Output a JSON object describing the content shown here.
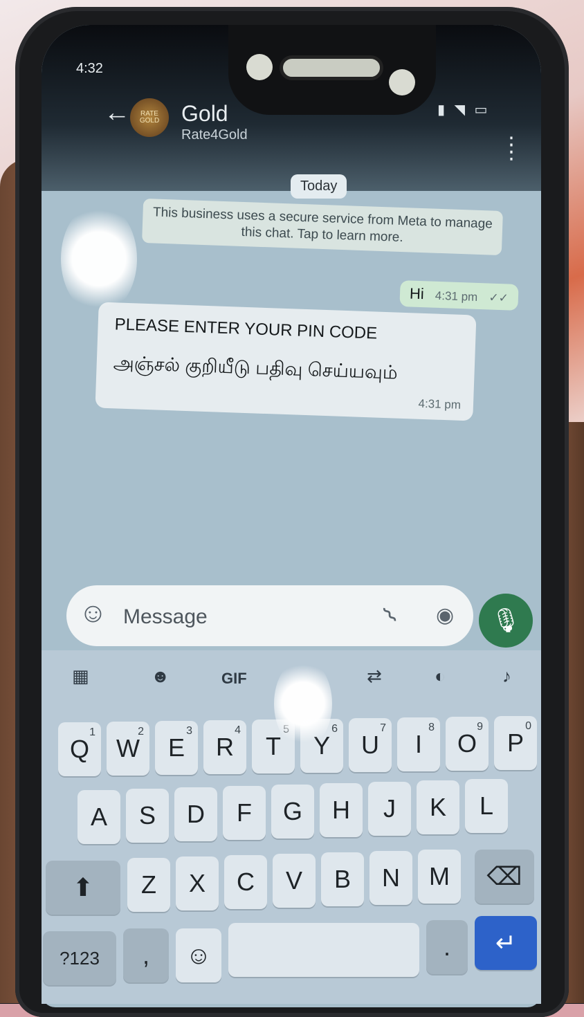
{
  "status_bar": {
    "time": "4:32",
    "icons": "▮ ◥ ▭"
  },
  "chat": {
    "back_icon": "back-arrow-icon",
    "avatar_text": "RATE GOLD",
    "name": "Gold",
    "subtitle": "Rate4Gold",
    "menu_icon": "more-vertical-icon"
  },
  "messages": {
    "date_label": "Today",
    "system_notice": "This business uses a secure service from Meta to manage this chat. Tap to learn more.",
    "outgoing": {
      "text": "Hi",
      "time": "4:31 pm",
      "ticks": "✓✓"
    },
    "incoming": {
      "line1": "PLEASE ENTER YOUR PIN CODE",
      "line2": "அஞ்சல் குறியீடு பதிவு செய்யவும்",
      "time": "4:31 pm"
    }
  },
  "composer": {
    "placeholder": "Message",
    "emoji_icon": "emoji-icon",
    "attach_icon": "paperclip-icon",
    "camera_icon": "camera-icon",
    "mic_icon": "microphone-icon"
  },
  "keyboard": {
    "toolbar": [
      "grid-icon",
      "sticker-icon",
      "GIF",
      "translate-icon",
      "palette-icon",
      "microphone-icon"
    ],
    "gif_label": "GIF",
    "row1": [
      "Q",
      "W",
      "E",
      "R",
      "T",
      "Y",
      "U",
      "I",
      "O",
      "P"
    ],
    "row1_hints": [
      "1",
      "2",
      "3",
      "4",
      "5",
      "6",
      "7",
      "8",
      "9",
      "0"
    ],
    "row2": [
      "A",
      "S",
      "D",
      "F",
      "G",
      "H",
      "J",
      "K",
      "L"
    ],
    "row3": [
      "Z",
      "X",
      "C",
      "V",
      "B",
      "N",
      "M"
    ],
    "symbols_label": "?123",
    "comma_label": ",",
    "period_label": ".",
    "shift_glyph": "⬆",
    "backspace_glyph": "⌫",
    "enter_glyph": "↵",
    "emoji_glyph": "☺",
    "colors": {
      "enter_key": "#2d62c9",
      "mic_button": "#2f7a4f"
    }
  }
}
